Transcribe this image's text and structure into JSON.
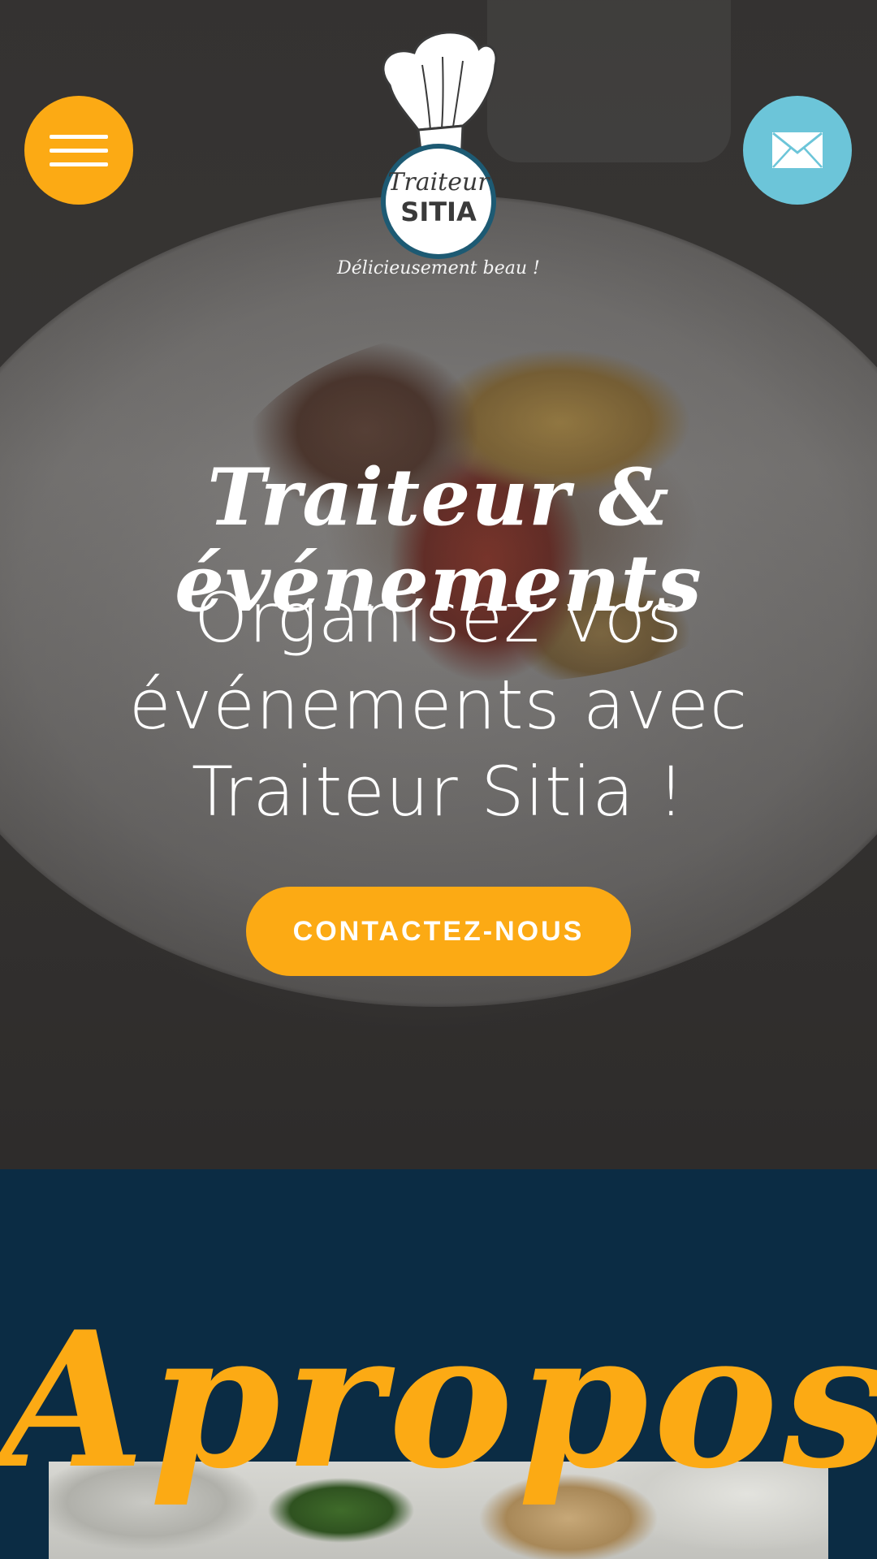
{
  "header": {
    "menu_icon": "hamburger-menu-icon",
    "mail_icon": "envelope-icon",
    "logo": {
      "line1": "Traiteur",
      "line2": "SITIA"
    },
    "tagline": "Délicieusement beau !"
  },
  "hero": {
    "script_title": "Traiteur & événements",
    "headline_lines": [
      "Organisez vos",
      "événements avec",
      "Traiteur Sitia !"
    ],
    "cta_label": "CONTACTEZ-NOUS"
  },
  "about": {
    "title": "Apropos"
  },
  "colors": {
    "accent_orange": "#fcaa14",
    "mail_blue": "#6cc5d9",
    "navy": "#0b2c44"
  }
}
